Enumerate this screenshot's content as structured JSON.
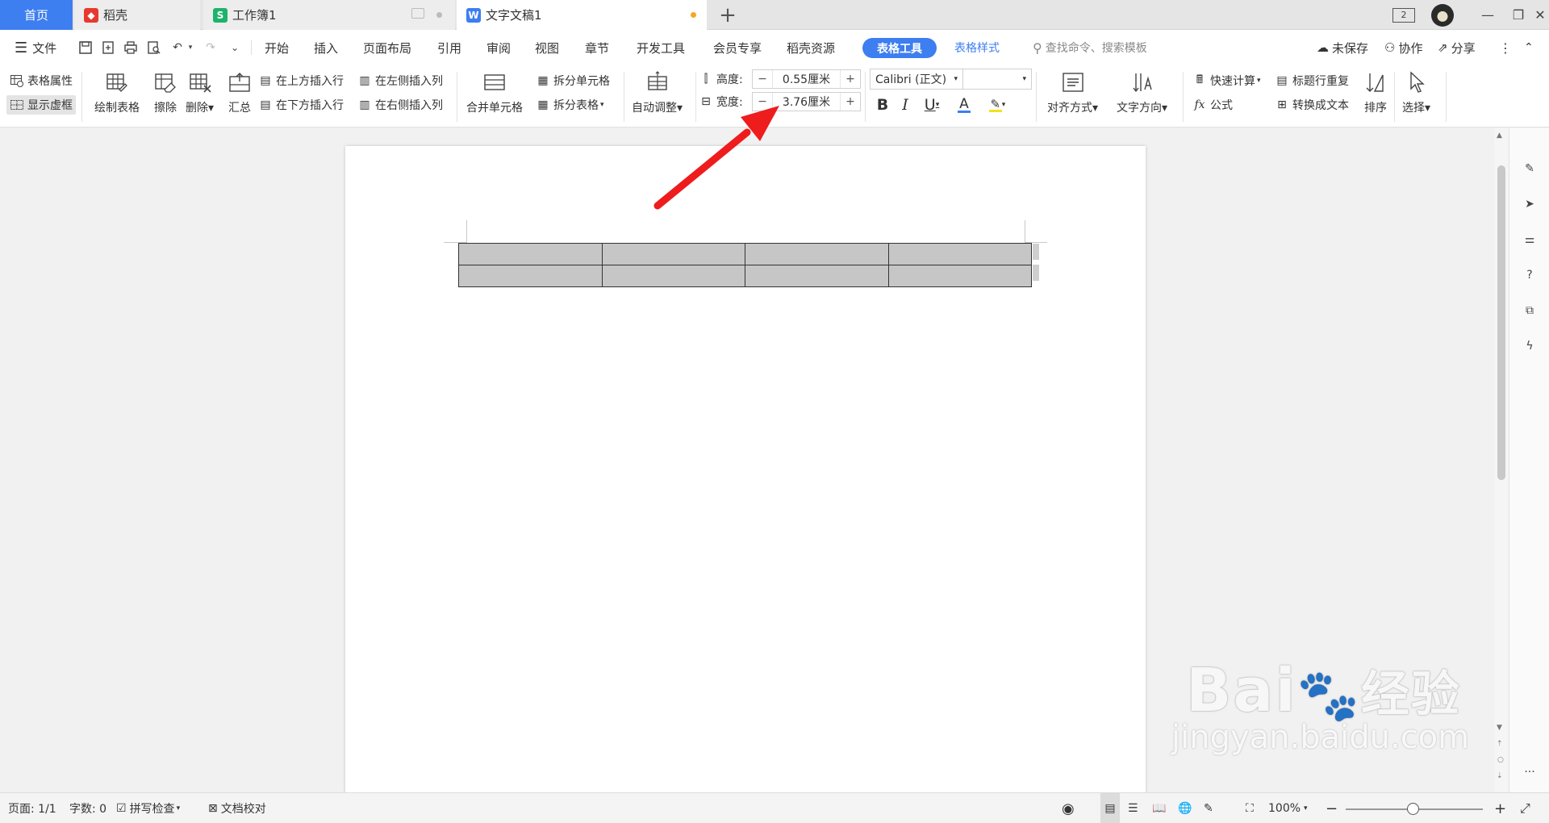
{
  "tabs": {
    "home": "首页",
    "daoke": "稻壳",
    "workbook": "工作簿1",
    "doc": "文字文稿1"
  },
  "menubar": {
    "file": "文件",
    "items": [
      "开始",
      "插入",
      "页面布局",
      "引用",
      "审阅",
      "视图",
      "章节",
      "开发工具",
      "会员专享",
      "稻壳资源"
    ],
    "table_tools": "表格工具",
    "table_style": "表格样式",
    "search": "查找命令、搜索模板",
    "unsaved": "未保存",
    "collab": "协作",
    "share": "分享"
  },
  "ribbon": {
    "table_props": "表格属性",
    "show_grid": "显示虚框",
    "draw_table": "绘制表格",
    "erase": "擦除",
    "delete": "删除",
    "summary": "汇总",
    "insert_row_above": "在上方插入行",
    "insert_row_below": "在下方插入行",
    "insert_col_left": "在左侧插入列",
    "insert_col_right": "在右侧插入列",
    "merge_cells": "合并单元格",
    "split_cells": "拆分单元格",
    "split_table": "拆分表格",
    "auto_fit": "自动调整",
    "height_label": "高度:",
    "height_value": "0.55厘米",
    "width_label": "宽度:",
    "width_value": "3.76厘米",
    "font_name": "Calibri (正文)",
    "font_size": "",
    "bold": "B",
    "italic": "I",
    "underline": "U",
    "font_color": "A",
    "align": "对齐方式",
    "text_direction": "文字方向",
    "quick_calc": "快速计算",
    "repeat_header": "标题行重复",
    "formula": "公式",
    "to_text": "转换成文本",
    "sort": "排序",
    "select": "选择"
  },
  "document": {
    "table": {
      "rows": 2,
      "cols": 4
    }
  },
  "watermark": {
    "brand": "Bai",
    "brand2": "经验",
    "url": "jingyan.baidu.com"
  },
  "status": {
    "page": "页面: 1/1",
    "words": "字数: 0",
    "spell": "拼写检查",
    "proof": "文档校对",
    "zoom": "100%"
  },
  "colors": {
    "accent": "#3d7ef0",
    "arrow": "#ee1c1c",
    "font_color_bar": "#3d7ef0",
    "highlight_bar": "#f2e31a"
  }
}
